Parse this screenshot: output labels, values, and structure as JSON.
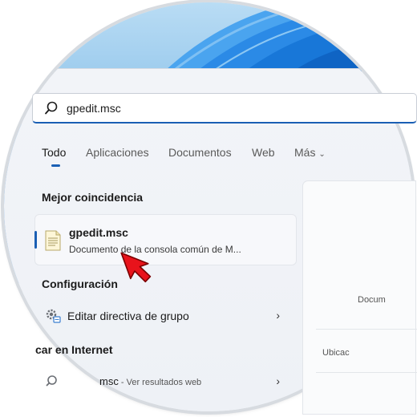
{
  "search": {
    "query": "gpedit.msc"
  },
  "tabs": [
    {
      "label": "Todo"
    },
    {
      "label": "Aplicaciones"
    },
    {
      "label": "Documentos"
    },
    {
      "label": "Web"
    },
    {
      "label": "Más"
    }
  ],
  "best_match": {
    "heading": "Mejor coincidencia",
    "title": "gpedit.msc",
    "subtitle": "Documento de la consola común de M..."
  },
  "settings": {
    "heading": "Configuración",
    "items": [
      {
        "label": "Editar directiva de grupo"
      }
    ]
  },
  "web": {
    "heading": "car en Internet",
    "items": [
      {
        "label": "msc",
        "suffix": " - Ver resultados web"
      }
    ]
  },
  "preview": {
    "type_text": "Docum",
    "location_text": "Ubicac"
  },
  "colors": {
    "accent": "#1a5fb4",
    "cursor": "#e8131b"
  }
}
